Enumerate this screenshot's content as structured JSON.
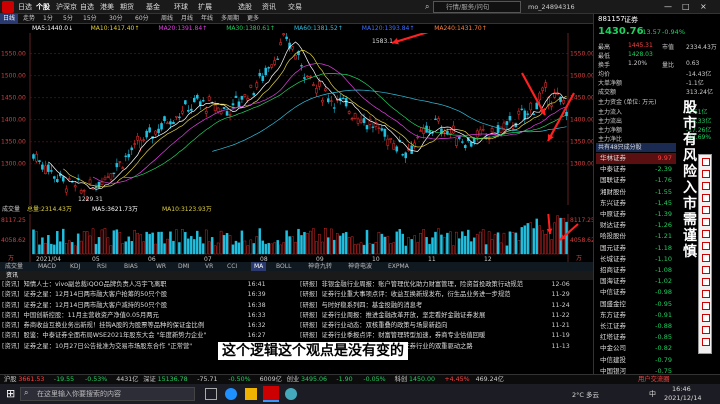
{
  "menus": [
    "日选",
    "个股",
    "沪深京",
    "自选",
    "港美",
    "期货",
    "基金",
    "环球",
    "扩展",
    "选股",
    "资讯",
    "交易"
  ],
  "menus_active": 1,
  "window_controls": [
    "—",
    "□",
    "×"
  ],
  "user": "mo_24894316",
  "search_placeholder": "行情/服务/问句",
  "tabs": [
    "日线",
    "走势",
    "1分",
    "5分",
    "15分",
    "30分",
    "60分",
    "周线",
    "月线",
    "年线",
    "多周期",
    "更多"
  ],
  "tabs_sel": 0,
  "ma_line": [
    {
      "t": "MA5:1440.0↓",
      "c": "#ffffff"
    },
    {
      "t": "MA10:1417.40↑",
      "c": "#e0d040"
    },
    {
      "t": "MA20:1391.84↑",
      "c": "#e040e0"
    },
    {
      "t": "MA30:1380.61↑",
      "c": "#20d060"
    },
    {
      "t": "MA60:1381.52↑",
      "c": "#30c0e0"
    },
    {
      "t": "MA120:1393.84↑",
      "c": "#4070ff"
    },
    {
      "t": "MA240:1431.70↑",
      "c": "#ff8040"
    }
  ],
  "price_axis": [
    "1550.00",
    "1500.00",
    "1450.00",
    "1400.00",
    "1350.00",
    "1300.00"
  ],
  "price_axis_right": [
    "1550.00",
    "1500.00",
    "1450.00",
    "1400.00",
    "1350.00",
    "1300.00"
  ],
  "high_label": "1583.1",
  "low_label": "1229.31",
  "vol_line": [
    {
      "t": "成交量",
      "c": "#cccccc"
    },
    {
      "t": "总量:2314.43万",
      "c": "#e0d040"
    },
    {
      "t": "MA5:3621.73万",
      "c": "#ffffff"
    },
    {
      "t": "MA10:3123.93万",
      "c": "#e0d040"
    }
  ],
  "vol_axis": [
    "8117.25",
    "4058.62",
    "万"
  ],
  "vol_axis_right": [
    "8117.25",
    "4058.62",
    "万"
  ],
  "x_dates": [
    "2021/04",
    "05",
    "06",
    "07",
    "08",
    "09",
    "10",
    "11",
    "12"
  ],
  "ind_tabs": [
    "成交量",
    "MACD",
    "KDJ",
    "RSI",
    "BIAS",
    "WR",
    "DMI",
    "VR",
    "CCI",
    "MA",
    "BOLL",
    "神奇九转",
    "神奇电波",
    "EXPMA"
  ],
  "news_header": {
    "left": "资讯",
    "right": ""
  },
  "news_left": [
    {
      "src": "[资讯]",
      "title": "知情人士：vivo副总裁iQOO品牌负责人冯宇飞离职",
      "time": "16:41"
    },
    {
      "src": "[资讯]",
      "title": "证券之星：12月14日两市融大客户抢筹的50只个股",
      "time": "16:39"
    },
    {
      "src": "[资讯]",
      "title": "证券之星：12月14日两市融大客户减持的50只个股",
      "time": "16:38"
    },
    {
      "src": "[资讯]",
      "title": "中国创新控股：11月主营收资产净值0.05月两元",
      "time": "16:33"
    },
    {
      "src": "[资讯]",
      "title": "券商收益互换业务出新规！挂钩A股的为股票等品种的保证金比例",
      "time": "16:32"
    },
    {
      "src": "[资讯]",
      "title": "股鉴：中泰证券全面布局WSE2021年股东大会 \"年度新势力企业\"",
      "time": "16:27"
    },
    {
      "src": "[资讯]",
      "title": "证券之星：10月27日公告批准为交易市场股东合作 \"正常营\"",
      "time": "16:24"
    }
  ],
  "news_right": [
    {
      "src": "[研报]",
      "title": "非银金融行业周报：账户管理优化助力财富管理，险资首投政策行动规范",
      "time": "12-06"
    },
    {
      "src": "[研报]",
      "title": "证券行业重大事项点评：收益互换新规发布，衍生品业务进一步规范",
      "time": "11-29"
    },
    {
      "src": "[研报]",
      "title": "与时好稳系列四：基金投融的消息考",
      "time": "11-24"
    },
    {
      "src": "[研报]",
      "title": "证券行业周报：推进金融改革开放，坚定看好金融证券发展",
      "time": "11-22"
    },
    {
      "src": "[研报]",
      "title": "证券行业动态：双核重叠的政策与场景新趋向",
      "time": "11-21"
    },
    {
      "src": "[研报]",
      "title": "证券行业季报点评：财富管理转型加速，券商专业估值回暖",
      "time": "11-19"
    },
    {
      "src": "[研报]",
      "title": "证券行业月报：合规与估值，证券行业的双重驱动之路",
      "time": "11-13"
    }
  ],
  "subtitle": "这个逻辑这个观点是没有变的",
  "vertical_text": "股市有风险入市需谨慎",
  "right_panel": {
    "code": "881157",
    "name": "证券",
    "price": "1430.76",
    "change": "-13.57",
    "pct": "-0.94%",
    "rows": [
      {
        "k": "最高",
        "v": "1445.31",
        "c": "#ff4040",
        "k2": "市值",
        "v2": "2334.43万"
      },
      {
        "k": "最低",
        "v": "1428.03",
        "c": "#20d060",
        "k2": "",
        "v2": ""
      },
      {
        "k": "换手",
        "v": "1.20%",
        "c": "#cccccc",
        "k2": "量比",
        "v2": "0.63"
      },
      {
        "k": "均价",
        "v": "",
        "c": "#cccccc",
        "k2": "",
        "v2": "-14.43亿"
      },
      {
        "k": "大单净额",
        "v": "",
        "c": "#cccccc",
        "k2": "",
        "v2": "-1.1亿"
      },
      {
        "k": "成交额",
        "v": "",
        "c": "#cccccc",
        "k2": "",
        "v2": "313.24亿"
      }
    ],
    "flow_title": "主力资金 (单位: 万元)",
    "flow": [
      {
        "k": "主力流入",
        "v": "-1.61亿"
      },
      {
        "k": "主力流出",
        "v": "-14.33亿"
      },
      {
        "k": "主力净额",
        "v": "-17.26亿"
      },
      {
        "k": "主力净比",
        "v": "-12.69%"
      }
    ],
    "stocks_title": "共有48只成分股",
    "stocks": [
      {
        "n": "华林证券",
        "v": "9.97",
        "c": "#ff4040"
      },
      {
        "n": "中泰证券",
        "v": "-2.39",
        "c": "#20d060"
      },
      {
        "n": "国联证券",
        "v": "-1.76",
        "c": "#20d060"
      },
      {
        "n": "湘财股份",
        "v": "-1.55",
        "c": "#20d060"
      },
      {
        "n": "东兴证券",
        "v": "-1.45",
        "c": "#20d060"
      },
      {
        "n": "中原证券",
        "v": "-1.39",
        "c": "#20d060"
      },
      {
        "n": "财达证券",
        "v": "-1.26",
        "c": "#20d060"
      },
      {
        "n": "哈投股份",
        "v": "-1.21",
        "c": "#20d060"
      },
      {
        "n": "国元证券",
        "v": "-1.18",
        "c": "#20d060"
      },
      {
        "n": "长城证券",
        "v": "-1.10",
        "c": "#20d060"
      },
      {
        "n": "招商证券",
        "v": "-1.08",
        "c": "#20d060"
      },
      {
        "n": "国海证券",
        "v": "-1.02",
        "c": "#20d060"
      },
      {
        "n": "中信证券",
        "v": "-0.98",
        "c": "#20d060"
      },
      {
        "n": "国盛金控",
        "v": "-0.95",
        "c": "#20d060"
      },
      {
        "n": "东方证券",
        "v": "-0.91",
        "c": "#20d060"
      },
      {
        "n": "长江证券",
        "v": "-0.88",
        "c": "#20d060"
      },
      {
        "n": "红塔证券",
        "v": "-0.85",
        "c": "#20d060"
      },
      {
        "n": "中金公司",
        "v": "-0.82",
        "c": "#20d060"
      },
      {
        "n": "中信建投",
        "v": "-0.79",
        "c": "#20d060"
      },
      {
        "n": "中国银河",
        "v": "-0.75",
        "c": "#20d060"
      },
      {
        "n": "哈高科",
        "v": "-0.71",
        "c": "#20d060"
      }
    ]
  },
  "status": [
    {
      "t": "沪股",
      "c": "#ccc"
    },
    {
      "t": "3661.53",
      "c": "#ff4040"
    },
    {
      "t": "-19.55",
      "c": "#20d060"
    },
    {
      "t": "-0.53%",
      "c": "#20d060"
    },
    {
      "t": "4431亿",
      "c": "#ccc"
    },
    {
      "t": "深证",
      "c": "#ccc"
    },
    {
      "t": "15136.78",
      "c": "#20d060"
    },
    {
      "t": "-75.71",
      "c": "-"
    },
    {
      "t": "-0.50%",
      "c": "#20d060"
    },
    {
      "t": "6009亿",
      "c": "#ccc"
    },
    {
      "t": "创业",
      "c": "#ccc"
    },
    {
      "t": "3495.06",
      "c": "#20d060"
    },
    {
      "t": "-1.90",
      "c": "#20d060"
    },
    {
      "t": "-0.05%",
      "c": "#20d060"
    },
    {
      "t": "科创",
      "c": "#ccc"
    },
    {
      "t": "1450.00",
      "c": "#20d060"
    },
    {
      "t": "+4.45%",
      "c": "#ff4040"
    },
    {
      "t": "469.24亿",
      "c": "#ccc"
    }
  ],
  "status_right": "用户交流圈",
  "taskbar": {
    "search_placeholder": "在这里输入你要搜索的内容",
    "time": "16:46",
    "date": "2021/12/14",
    "temp": "2°C 多云",
    "ime": "中"
  }
}
